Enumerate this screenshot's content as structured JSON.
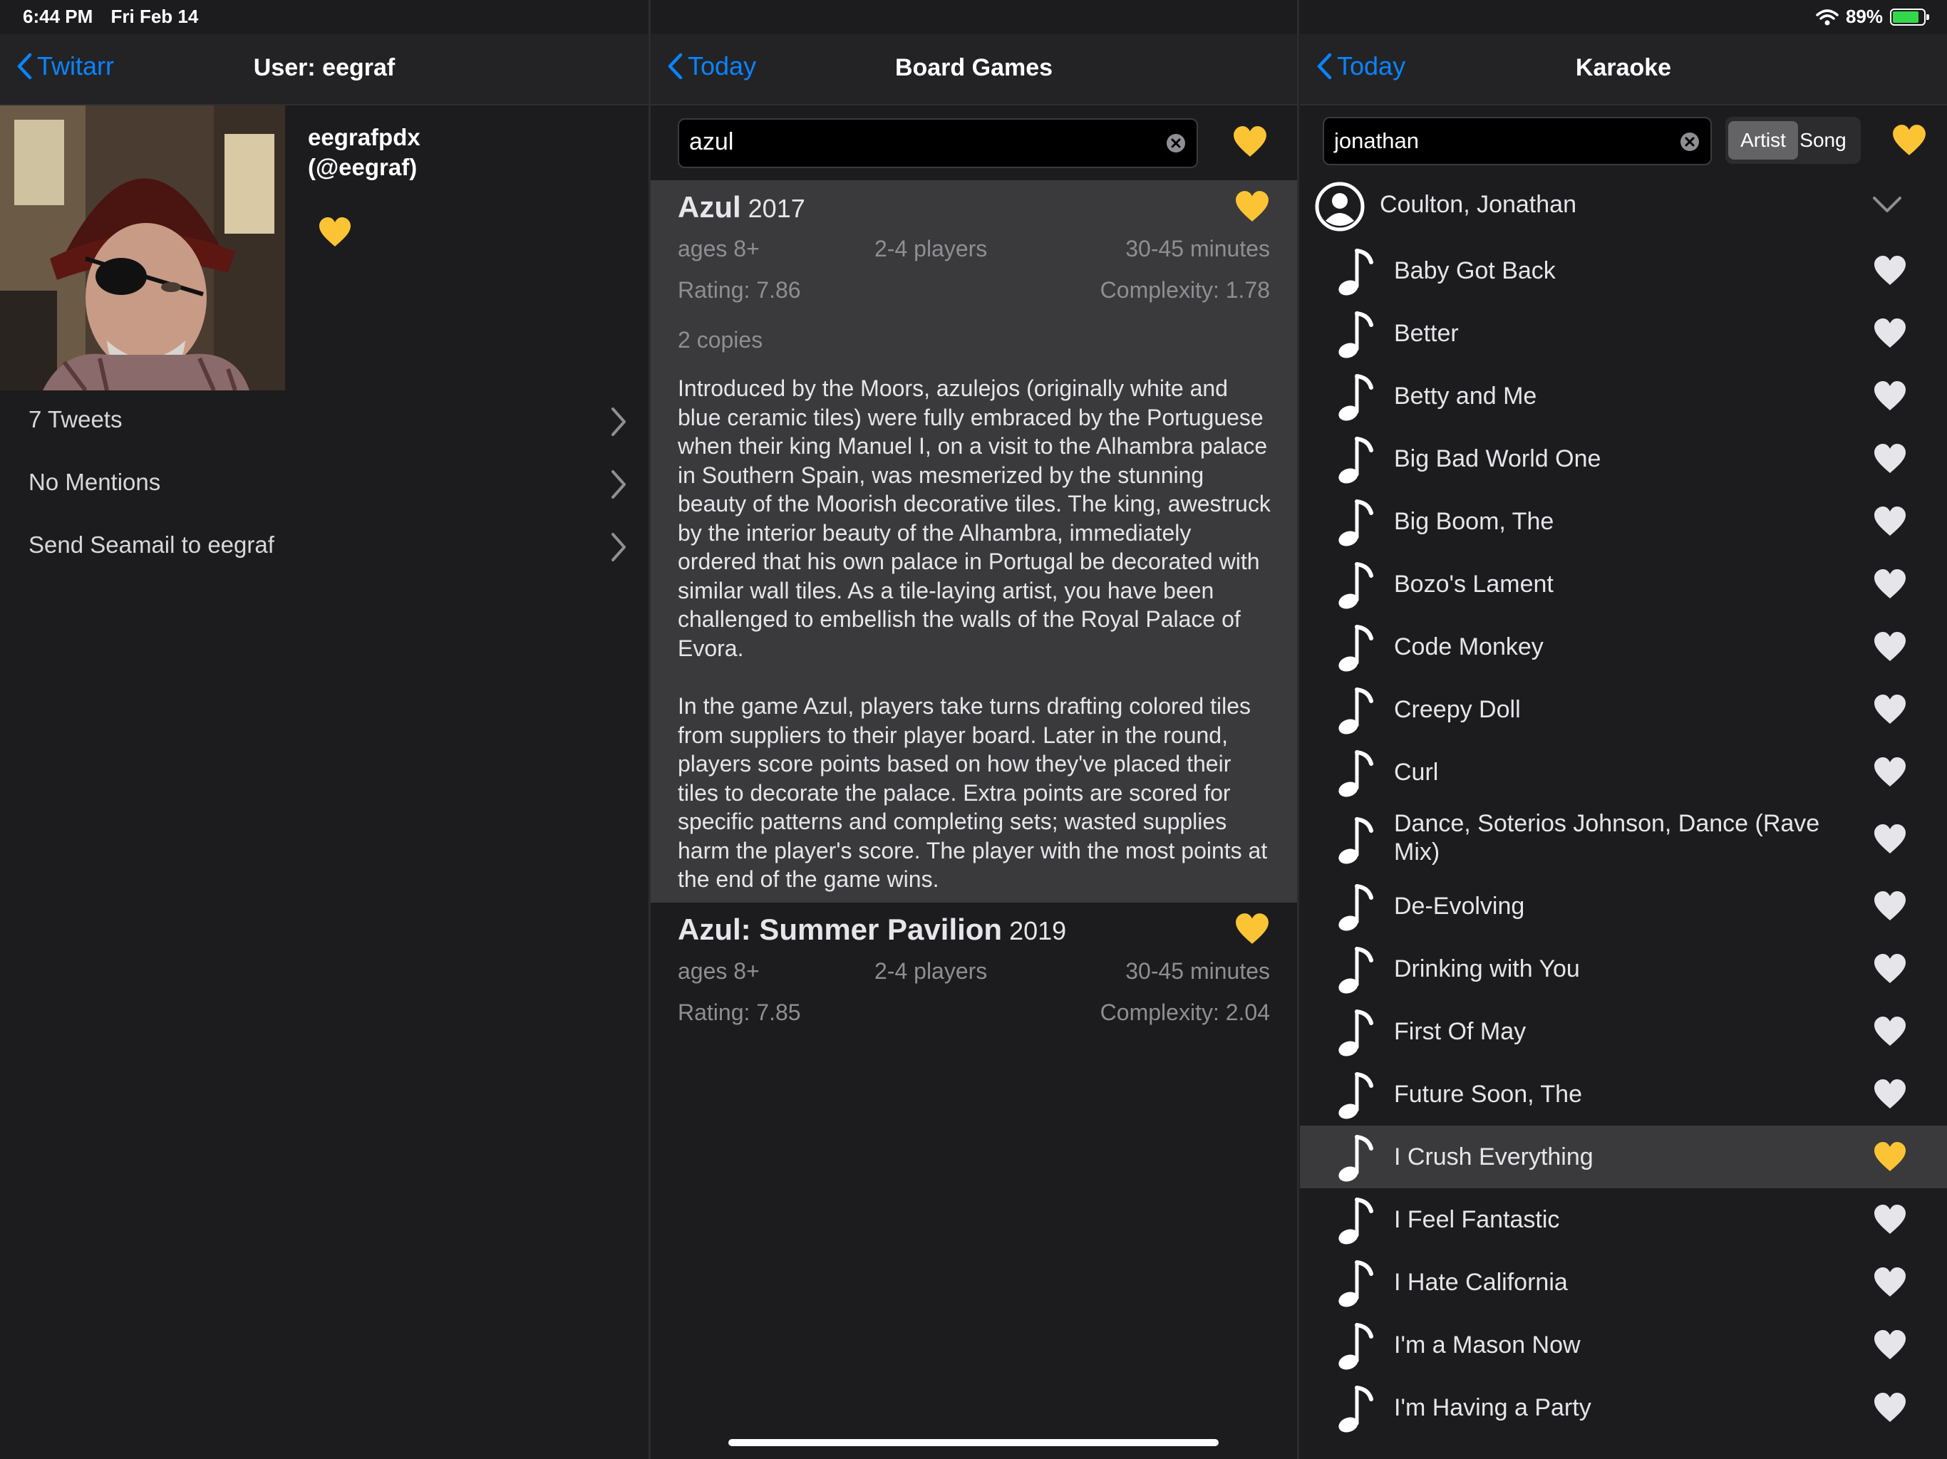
{
  "status": {
    "time": "6:44 PM",
    "date": "Fri Feb 14",
    "battery": "89%"
  },
  "colors": {
    "accent": "#0a84ff",
    "heart_yellow": "#fcc434",
    "heart_white": "#e5e5ea",
    "battery_green": "#32d74b"
  },
  "left": {
    "back_label": "Twitarr",
    "title": "User: eegraf",
    "display_name": "eegrafpdx",
    "handle": "(@eegraf)",
    "menu": [
      {
        "label": "7 Tweets"
      },
      {
        "label": "No Mentions"
      },
      {
        "label": "Send Seamail to eegraf"
      }
    ]
  },
  "middle": {
    "back_label": "Today",
    "title": "Board Games",
    "search_value": "azul",
    "games": [
      {
        "title": "Azul",
        "year": "2017",
        "ages": "ages 8+",
        "players": "2-4 players",
        "time": "30-45 minutes",
        "rating": "Rating: 7.86",
        "complexity": "Complexity: 1.78",
        "copies": "2 copies",
        "description_1": "Introduced by the Moors, azulejos (originally white and blue ceramic tiles) were fully embraced by the Portuguese when their king Manuel I, on a visit to the Alhambra palace in Southern Spain, was mesmerized by the stunning beauty of the Moorish decorative tiles. The king, awestruck by the interior beauty of the Alhambra, immediately ordered that his own palace in Portugal be decorated with similar wall tiles. As a tile-laying artist, you have been challenged to embellish the walls of the Royal Palace of Evora.",
        "description_2": "In the game Azul, players take turns drafting colored tiles from suppliers to their player board. Later in the round, players score points based on how they've placed their tiles to decorate the palace. Extra points are scored for specific patterns and completing sets; wasted supplies harm the player's score. The player with the most points at the end of the game wins."
      },
      {
        "title": "Azul: Summer Pavilion",
        "year": "2019",
        "ages": "ages 8+",
        "players": "2-4 players",
        "time": "30-45 minutes",
        "rating": "Rating: 7.85",
        "complexity": "Complexity: 2.04"
      }
    ]
  },
  "right": {
    "back_label": "Today",
    "title": "Karaoke",
    "search_value": "jonathan",
    "segment": {
      "active": "Artist",
      "inactive": "Song"
    },
    "artist": "Coulton, Jonathan",
    "songs": [
      {
        "title": "Baby Got Back",
        "favorite": false
      },
      {
        "title": "Better",
        "favorite": false
      },
      {
        "title": "Betty and Me",
        "favorite": false
      },
      {
        "title": "Big Bad World One",
        "favorite": false
      },
      {
        "title": "Big Boom, The",
        "favorite": false
      },
      {
        "title": "Bozo's Lament",
        "favorite": false
      },
      {
        "title": "Code Monkey",
        "favorite": false
      },
      {
        "title": "Creepy Doll",
        "favorite": false
      },
      {
        "title": "Curl",
        "favorite": false
      },
      {
        "title": "Dance, Soterios Johnson, Dance (Rave Mix)",
        "favorite": false
      },
      {
        "title": "De-Evolving",
        "favorite": false
      },
      {
        "title": "Drinking with You",
        "favorite": false
      },
      {
        "title": "First Of May",
        "favorite": false
      },
      {
        "title": "Future Soon, The",
        "favorite": false
      },
      {
        "title": "I Crush Everything",
        "favorite": true
      },
      {
        "title": "I Feel Fantastic",
        "favorite": false
      },
      {
        "title": "I Hate California",
        "favorite": false
      },
      {
        "title": "I'm a Mason Now",
        "favorite": false
      },
      {
        "title": "I'm Having a Party",
        "favorite": false
      }
    ]
  }
}
